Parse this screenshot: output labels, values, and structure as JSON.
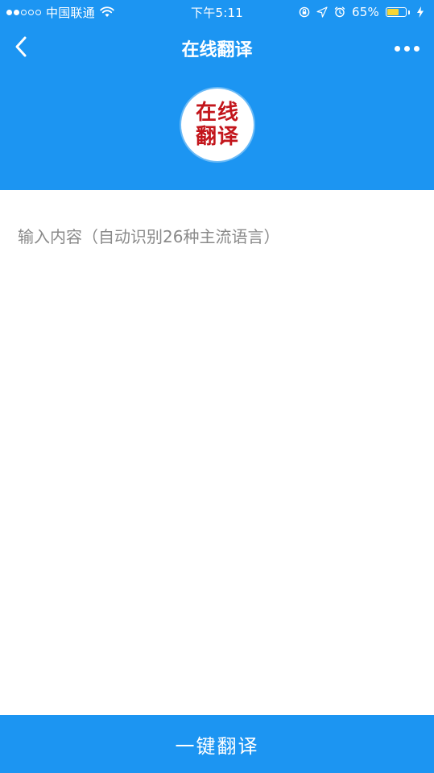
{
  "status_bar": {
    "carrier": "中国联通",
    "time": "下午5:11",
    "battery_percent": "65%",
    "battery_level": 0.65,
    "icons": [
      "signal-dots",
      "wifi-icon",
      "rotation-lock-icon",
      "location-arrow-icon",
      "alarm-icon",
      "battery-icon",
      "charging-bolt-icon"
    ]
  },
  "nav": {
    "title": "在线翻译",
    "back_icon": "chevron-left-icon",
    "more_icon": "more-dots-icon"
  },
  "logo": {
    "line1": "在线",
    "line2": "翻译"
  },
  "input": {
    "placeholder": "输入内容（自动识别26种主流语言）",
    "value": ""
  },
  "action": {
    "translate_label": "一键翻译"
  },
  "colors": {
    "primary": "#1c95f2",
    "logo_text": "#c3161c",
    "placeholder": "#8a8a8a",
    "battery": "#f7d533"
  }
}
